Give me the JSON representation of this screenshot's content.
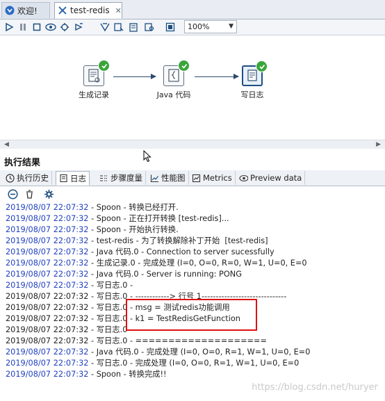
{
  "tabs": [
    {
      "label": "欢迎!",
      "icon": "kettle-icon"
    },
    {
      "label": "test-redis",
      "icon": "transformation-icon",
      "close": "✕"
    }
  ],
  "toolbar": {
    "zoom": "100%"
  },
  "canvas": {
    "steps": [
      {
        "label": "生成记录",
        "icon": "generate-rows-icon",
        "status": "success"
      },
      {
        "label": "Java 代码",
        "icon": "java-code-icon",
        "status": "success"
      },
      {
        "label": "写日志",
        "icon": "write-log-icon",
        "status": "success"
      }
    ]
  },
  "results": {
    "title": "执行结果",
    "tabs": [
      {
        "label": "执行历史",
        "icon": "history-icon"
      },
      {
        "label": "日志",
        "icon": "log-icon"
      },
      {
        "label": "步骤度量",
        "icon": "step-metrics-icon"
      },
      {
        "label": "性能图",
        "icon": "performance-graph-icon"
      },
      {
        "label": "Metrics",
        "icon": "metrics-icon"
      },
      {
        "label": "Preview data",
        "icon": "preview-icon"
      }
    ]
  },
  "log": [
    {
      "ts": "2019/08/07 22:07:32",
      "msg": " - Spoon - 转换已经打开.",
      "blue": true
    },
    {
      "ts": "2019/08/07 22:07:32",
      "msg": " - Spoon - 正在打开转换 [test-redis]...",
      "blue": true
    },
    {
      "ts": "2019/08/07 22:07:32",
      "msg": " - Spoon - 开始执行转换.",
      "blue": true
    },
    {
      "ts": "2019/08/07 22:07:32",
      "msg": " - test-redis - 为了转换解除补丁开始  [test-redis]",
      "blue": true
    },
    {
      "ts": "2019/08/07 22:07:32",
      "msg": " - Java 代码.0 - Connection to server sucessfully",
      "blue": true
    },
    {
      "ts": "2019/08/07 22:07:32",
      "msg": " - 生成记录.0 - 完成处理 (I=0, O=0, R=0, W=1, U=0, E=0",
      "blue": true
    },
    {
      "ts": "2019/08/07 22:07:32",
      "msg": " - Java 代码.0 - Server is running: PONG",
      "blue": true
    },
    {
      "ts": "2019/08/07 22:07:32",
      "msg": " - 写日志.0 -",
      "blue": true
    },
    {
      "ts": "2019/08/07 22:07:32",
      "msg": " - 写日志.0 - ------------> 行号 1------------------------------",
      "blue": false
    },
    {
      "ts": "2019/08/07 22:07:32",
      "msg": " - 写日志.0 - msg = 测试redis功能调用",
      "blue": false
    },
    {
      "ts": "2019/08/07 22:07:32",
      "msg": " - 写日志.0 - k1 = TestRedisGetFunction",
      "blue": false
    },
    {
      "ts": "2019/08/07 22:07:32",
      "msg": " - 写日志.0 -",
      "blue": false
    },
    {
      "ts": "2019/08/07 22:07:32",
      "msg": " - 写日志.0 - ====================",
      "blue": false
    },
    {
      "ts": "2019/08/07 22:07:32",
      "msg": " - Java 代码.0 - 完成处理 (I=0, O=0, R=1, W=1, U=0, E=0",
      "blue": true
    },
    {
      "ts": "2019/08/07 22:07:32",
      "msg": " - 写日志.0 - 完成处理 (I=0, O=0, R=1, W=1, U=0, E=0",
      "blue": true
    },
    {
      "ts": "2019/08/07 22:07:32",
      "msg": " - Spoon - 转换完成!!",
      "blue": true
    }
  ],
  "watermark": "https://blog.csdn.net/huryer",
  "colors": {
    "timestamp": "#1f3fbf",
    "success": "#3aa53a",
    "highlight": "#e01010"
  }
}
